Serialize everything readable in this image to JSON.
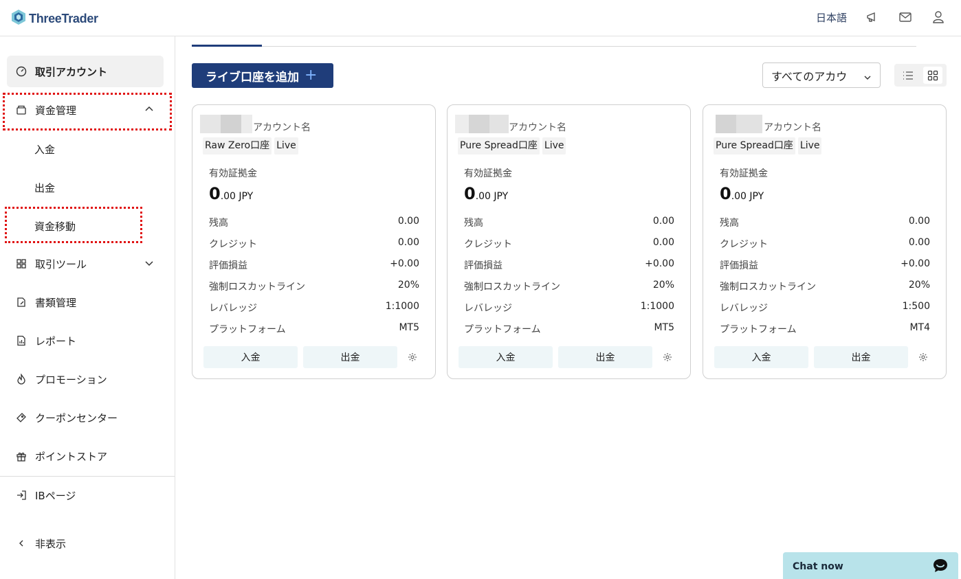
{
  "header": {
    "logo_text": "ThreeTrader",
    "language": "日本語",
    "icons": [
      "megaphone-icon",
      "mail-icon",
      "user-icon"
    ]
  },
  "sidebar": {
    "items": [
      {
        "label": "取引アカウント",
        "icon": "gauge-icon",
        "active": true
      },
      {
        "label": "資金管理",
        "icon": "wallet-icon",
        "expanded": true
      },
      {
        "label": "取引ツール",
        "icon": "grid-plus-icon",
        "expanded": false
      },
      {
        "label": "書類管理",
        "icon": "document-edit-icon"
      },
      {
        "label": "レポート",
        "icon": "report-icon"
      },
      {
        "label": "プロモーション",
        "icon": "flame-icon"
      },
      {
        "label": "クーポンセンター",
        "icon": "ticket-icon"
      },
      {
        "label": "ポイントストア",
        "icon": "gift-icon"
      }
    ],
    "funds_sub": [
      "入金",
      "出金",
      "資金移動"
    ],
    "ib_page": "IBページ",
    "hide": "非表示"
  },
  "toolbar": {
    "add_button": "ライブ口座を追加",
    "filter_value": "すべてのアカウ"
  },
  "card_labels": {
    "account_name": "アカウント名",
    "equity": "有効証拠金",
    "rows": [
      "残高",
      "クレジット",
      "評価損益",
      "強制ロスカットライン",
      "レバレッジ",
      "プラットフォーム"
    ],
    "deposit": "入金",
    "withdraw": "出金"
  },
  "accounts": [
    {
      "type": "Raw Zero口座",
      "status": "Live",
      "equity_int": "0",
      "equity_dec": ".00 JPY",
      "values": [
        "0.00",
        "0.00",
        "+0.00",
        "20%",
        "1:1000",
        "MT5"
      ]
    },
    {
      "type": "Pure Spread口座",
      "status": "Live",
      "equity_int": "0",
      "equity_dec": ".00 JPY",
      "values": [
        "0.00",
        "0.00",
        "+0.00",
        "20%",
        "1:1000",
        "MT5"
      ]
    },
    {
      "type": "Pure Spread口座",
      "status": "Live",
      "equity_int": "0",
      "equity_dec": ".00 JPY",
      "values": [
        "0.00",
        "0.00",
        "+0.00",
        "20%",
        "1:500",
        "MT4"
      ]
    }
  ],
  "chat": {
    "label": "Chat now"
  },
  "colors": {
    "brand": "#1f3d7a",
    "highlight": "#e01010",
    "chat": "#b8e3ea"
  }
}
